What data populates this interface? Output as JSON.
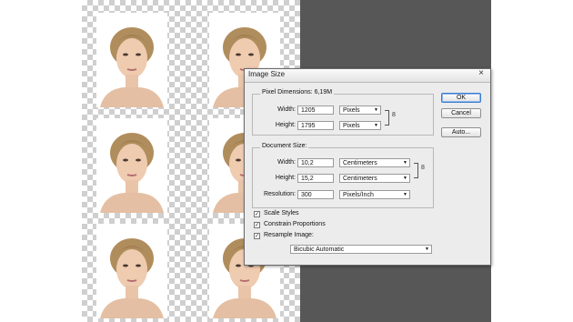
{
  "dialog": {
    "title": "Image Size",
    "close_glyph": "×",
    "buttons": {
      "ok": "OK",
      "cancel": "Cancel",
      "auto": "Auto..."
    },
    "pixel_dimensions": {
      "label": "Pixel Dimensions:",
      "value": "6,19M",
      "width_label": "Width:",
      "width_value": "1205",
      "width_unit": "Pixels",
      "height_label": "Height:",
      "height_value": "1795",
      "height_unit": "Pixels"
    },
    "document_size": {
      "label": "Document Size:",
      "width_label": "Width:",
      "width_value": "10,2",
      "width_unit": "Centimeters",
      "height_label": "Height:",
      "height_value": "15,2",
      "height_unit": "Centimeters",
      "resolution_label": "Resolution:",
      "resolution_value": "300",
      "resolution_unit": "Pixels/Inch"
    },
    "options": {
      "scale_styles": {
        "label": "Scale Styles",
        "checked": true
      },
      "constrain_proportions": {
        "label": "Constrain Proportions",
        "checked": true
      },
      "resample_image": {
        "label": "Resample Image:",
        "checked": true
      },
      "resample_method": "Bicubic Automatic"
    }
  },
  "colors": {
    "pasteboard": "#575757",
    "dialog_bg": "#ececec",
    "default_button_border": "#3b7bd0"
  },
  "icons": {
    "link": "chain-link-icon",
    "dropdown": "chevron-down-icon",
    "check": "checkmark-icon"
  }
}
